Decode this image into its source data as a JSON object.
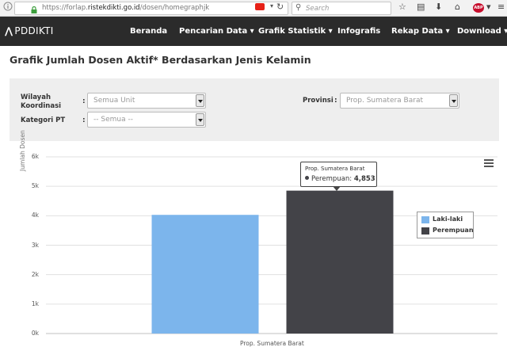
{
  "browser": {
    "url_prefix": "https://forlap.",
    "url_domain": "ristekdikti.go.id",
    "url_path": "/dosen/homegraphjk",
    "search_placeholder": "Search"
  },
  "site": {
    "logo": "PDDIKTI",
    "nav": [
      {
        "label": "Beranda"
      },
      {
        "label": "Pencarian Data ▾"
      },
      {
        "label": "Grafik Statistik ▾"
      },
      {
        "label": "Infografis"
      },
      {
        "label": "Rekap Data ▾"
      },
      {
        "label": "Download ▾"
      }
    ]
  },
  "page": {
    "title": "Grafik Jumlah Dosen Aktif* Berdasarkan Jenis Kelamin"
  },
  "filters": {
    "wilayah_label": "Wilayah Koordinasi",
    "wilayah_value": "Semua Unit",
    "kategori_label": "Kategori PT",
    "kategori_value": "-- Semua --",
    "provinsi_label": "Provinsi",
    "provinsi_value": "Prop. Sumatera Barat",
    "colon": ":"
  },
  "chart_data": {
    "type": "bar",
    "categories": [
      "Prop. Sumatera Barat"
    ],
    "series": [
      {
        "name": "Laki-laki",
        "values": [
          4030
        ],
        "color": "#7cb5ec"
      },
      {
        "name": "Perempuan",
        "values": [
          4853
        ],
        "color": "#434348"
      }
    ],
    "ylabel": "Jumlah Dosen",
    "ylim": [
      0,
      6000
    ],
    "yticks": [
      "0k",
      "1k",
      "2k",
      "3k",
      "4k",
      "5k",
      "6k"
    ],
    "grid": true,
    "legend_position": "right",
    "tooltip": {
      "category": "Prop. Sumatera Barat",
      "series": "Perempuan",
      "value": "4,853"
    }
  }
}
